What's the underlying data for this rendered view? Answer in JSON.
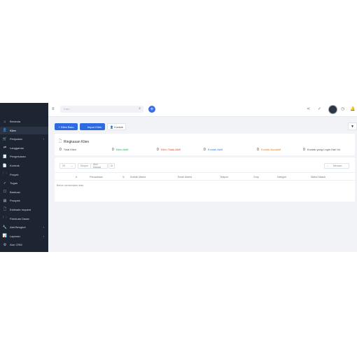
{
  "sidebar": {
    "items": [
      {
        "icon": "home-icon",
        "glyph": "⌂",
        "label": "Beranda"
      },
      {
        "icon": "user-icon",
        "glyph": "👤",
        "label": "Klien",
        "active": true
      },
      {
        "icon": "cart-icon",
        "glyph": "🛒",
        "label": "Penjualan",
        "arrow": "‹"
      },
      {
        "icon": "refresh-icon",
        "glyph": "⇄",
        "label": "Langganan"
      },
      {
        "icon": "receipt-icon",
        "glyph": "🧾",
        "label": "Pengeluaran"
      },
      {
        "icon": "contract-icon",
        "glyph": "📄",
        "label": "Kontrak"
      },
      {
        "icon": "folder-icon",
        "glyph": "🗀",
        "label": "Proyek"
      },
      {
        "icon": "check-circle-icon",
        "glyph": "✓",
        "label": "Tugas"
      },
      {
        "icon": "inbox-icon",
        "glyph": "☐",
        "label": "Bantuan"
      },
      {
        "icon": "prospect-icon",
        "glyph": "▤",
        "label": "Prospek"
      },
      {
        "icon": "file-icon",
        "glyph": "🗋",
        "label": "Estimate request"
      },
      {
        "icon": "book-icon",
        "glyph": "🗁",
        "label": "Panduan Dasar"
      },
      {
        "icon": "wrench-icon",
        "glyph": "🔧",
        "label": "Alat Bengkel",
        "arrow": "‹"
      },
      {
        "icon": "chart-icon",
        "glyph": "📊",
        "label": "Laporan",
        "arrow": "‹"
      },
      {
        "icon": "gear-icon",
        "glyph": "⚙",
        "label": "Atur CRM"
      }
    ]
  },
  "topbar": {
    "search_placeholder": "Cari...",
    "search_icon": "⌕",
    "menu_icon": "≡",
    "plus_label": "+",
    "share_icon": "⋖",
    "check_icon": "✓",
    "clock_icon": "◷",
    "bell_icon": "🔔"
  },
  "toolbar": {
    "new_client": "+ Klien Baru",
    "import_client": "👤 Impor Klien",
    "contact": "👤 Kontak",
    "filter_icon": "▼"
  },
  "summary": {
    "title": "Ringkasan Klien",
    "stats": [
      {
        "value": "0",
        "label": "Total Klien",
        "color": "#555555"
      },
      {
        "value": "0",
        "label": "Klien Aktif",
        "color": "#27ae60"
      },
      {
        "value": "0",
        "label": "Klien Tidak Aktif",
        "color": "#e74c3c"
      },
      {
        "value": "0",
        "label": "Kontak Aktif",
        "color": "#2f80ed"
      },
      {
        "value": "0",
        "label": "Kontak Nonaktif",
        "color": "#e67e22"
      },
      {
        "value": "0",
        "label": "Kontak yang Login Hari Ini",
        "color": "#555555"
      }
    ]
  },
  "table": {
    "page_size": "25",
    "export_label": "Ekspor",
    "bulk_label": "Aksi Massal",
    "search_placeholder": "Mencari",
    "columns": [
      "#",
      "Perusahaan",
      "Kontak Utama",
      "Email Utama",
      "Telepon",
      "Grup",
      "Kategori",
      "Waktu Masuk"
    ],
    "empty_text": "Belum menemukan data"
  }
}
